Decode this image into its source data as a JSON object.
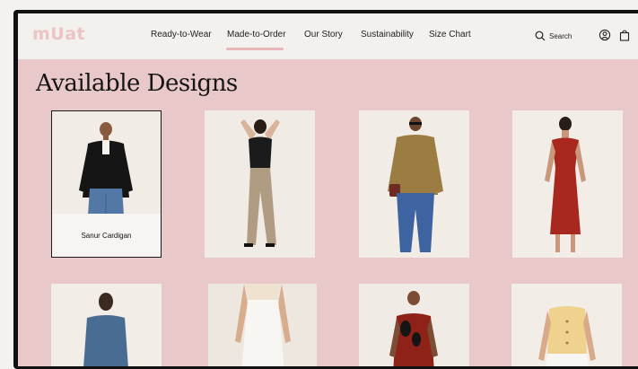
{
  "brand": {
    "logo": "mUat",
    "logo_color": "#ecc4c4"
  },
  "nav": {
    "items": [
      {
        "label": "Ready-to-Wear"
      },
      {
        "label": "Made-to-Order",
        "active": true
      },
      {
        "label": "Our Story"
      },
      {
        "label": "Sustainability"
      },
      {
        "label": "Size Chart"
      }
    ],
    "search_label": "Search",
    "icons": [
      "search-icon",
      "account-icon",
      "bag-icon"
    ]
  },
  "page": {
    "title": "Available Designs",
    "background": "#e8c8c9"
  },
  "products": [
    {
      "name": "Sanur Cardigan",
      "hovered": true
    },
    {
      "name": ""
    },
    {
      "name": ""
    },
    {
      "name": ""
    },
    {
      "name": ""
    },
    {
      "name": ""
    },
    {
      "name": ""
    },
    {
      "name": ""
    }
  ]
}
